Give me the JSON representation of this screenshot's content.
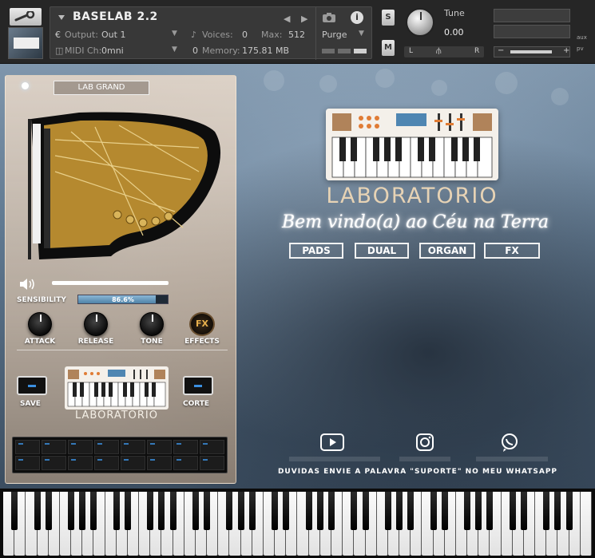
{
  "header": {
    "instrument_name": "BASELAB 2.2",
    "output_label": "Output:",
    "output_value": "Out 1",
    "voices_label": "Voices:",
    "voices_value": "0",
    "max_label": "Max:",
    "max_value": "512",
    "purge_label": "Purge",
    "midi_label": "MIDI Ch:",
    "midi_value": "0mni",
    "memory_prefix": "0",
    "memory_label": "Memory:",
    "memory_value": "175.81 MB",
    "solo_label": "S",
    "mute_label": "M",
    "tune_label": "Tune",
    "tune_value": "0.00",
    "pan_left": "L",
    "pan_right": "R",
    "aux_label": "aux",
    "pv_label": "pv",
    "vol_minus": "−",
    "vol_plus": "+"
  },
  "left_panel": {
    "preset_name": "LAB GRAND",
    "sensibility_label": "SENSIBILITY",
    "sensibility_value": "86.6%",
    "sensibility_fraction": 0.866,
    "knobs": [
      {
        "label": "ATTACK"
      },
      {
        "label": "RELEASE"
      },
      {
        "label": "TONE"
      }
    ],
    "fx_button_label": "FX",
    "effects_label": "EFFECTS",
    "save_label": "SAVE",
    "corte_label": "CORTE",
    "brand_small": "LABORATORIO"
  },
  "main": {
    "brand_title": "LABORATORIO",
    "tagline": "Bem vindo(a) ao Céu na Terra",
    "modes": [
      "PADS",
      "DUAL",
      "ORGAN",
      "FX"
    ],
    "footer": "DUVIDAS ENVIE A PALAVRA \"SUPORTE\" NO MEU WHATSAPP",
    "social_icons": [
      "youtube-icon",
      "instagram-icon",
      "whatsapp-icon"
    ]
  },
  "colors": {
    "accent_blue": "#3b8fe0",
    "fx_gold": "#e8b04c",
    "brand_cream": "#e7d3b5"
  }
}
